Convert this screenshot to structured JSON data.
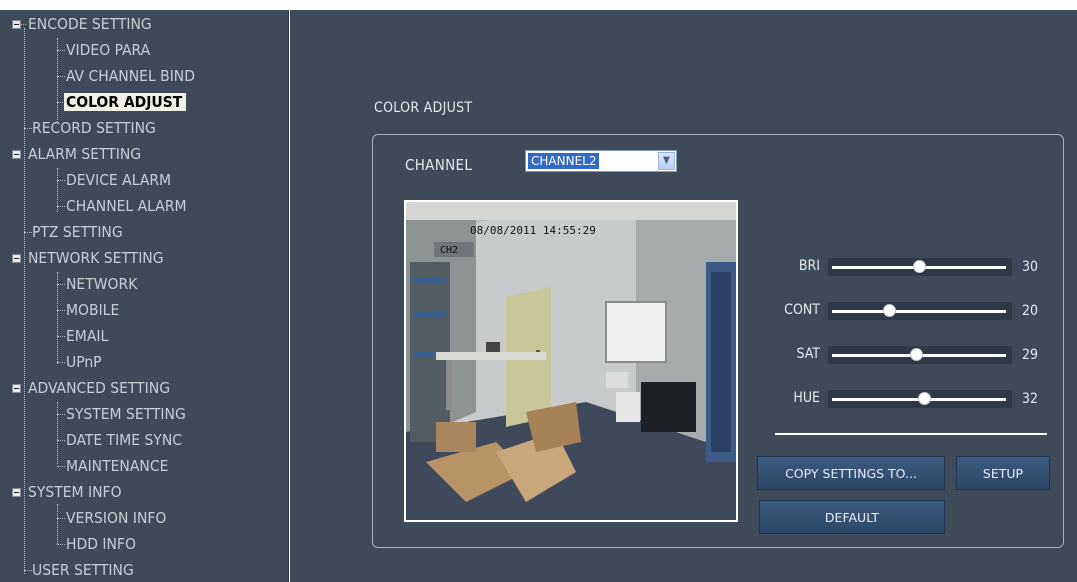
{
  "sidebar": {
    "items": [
      {
        "label": "ENCODE SETTING"
      },
      {
        "label": "VIDEO PARA"
      },
      {
        "label": "AV CHANNEL BIND"
      },
      {
        "label": "COLOR ADJUST"
      },
      {
        "label": "RECORD SETTING"
      },
      {
        "label": "ALARM SETTING"
      },
      {
        "label": "DEVICE ALARM"
      },
      {
        "label": "CHANNEL ALARM"
      },
      {
        "label": "PTZ SETTING"
      },
      {
        "label": "NETWORK SETTING"
      },
      {
        "label": "NETWORK"
      },
      {
        "label": "MOBILE"
      },
      {
        "label": "EMAIL"
      },
      {
        "label": "UPnP"
      },
      {
        "label": "ADVANCED SETTING"
      },
      {
        "label": "SYSTEM SETTING"
      },
      {
        "label": "DATE TIME SYNC"
      },
      {
        "label": "MAINTENANCE"
      },
      {
        "label": "SYSTEM INFO"
      },
      {
        "label": "VERSION INFO"
      },
      {
        "label": "HDD INFO"
      },
      {
        "label": "USER SETTING"
      }
    ]
  },
  "main": {
    "section_title": "COLOR ADJUST",
    "channel_label": "CHANNEL",
    "channel_value": "CHANNEL2",
    "video": {
      "timestamp": "08/08/2011 14:55:29",
      "channel_tag": "CH2"
    },
    "sliders": [
      {
        "label": "BRI",
        "value": "30",
        "fraction": 0.5
      },
      {
        "label": "CONT",
        "value": "20",
        "fraction": 0.33
      },
      {
        "label": "SAT",
        "value": "29",
        "fraction": 0.48
      },
      {
        "label": "HUE",
        "value": "32",
        "fraction": 0.53
      }
    ],
    "buttons": {
      "copy": "COPY SETTINGS TO...",
      "setup": "SETUP",
      "default": "DEFAULT"
    }
  }
}
